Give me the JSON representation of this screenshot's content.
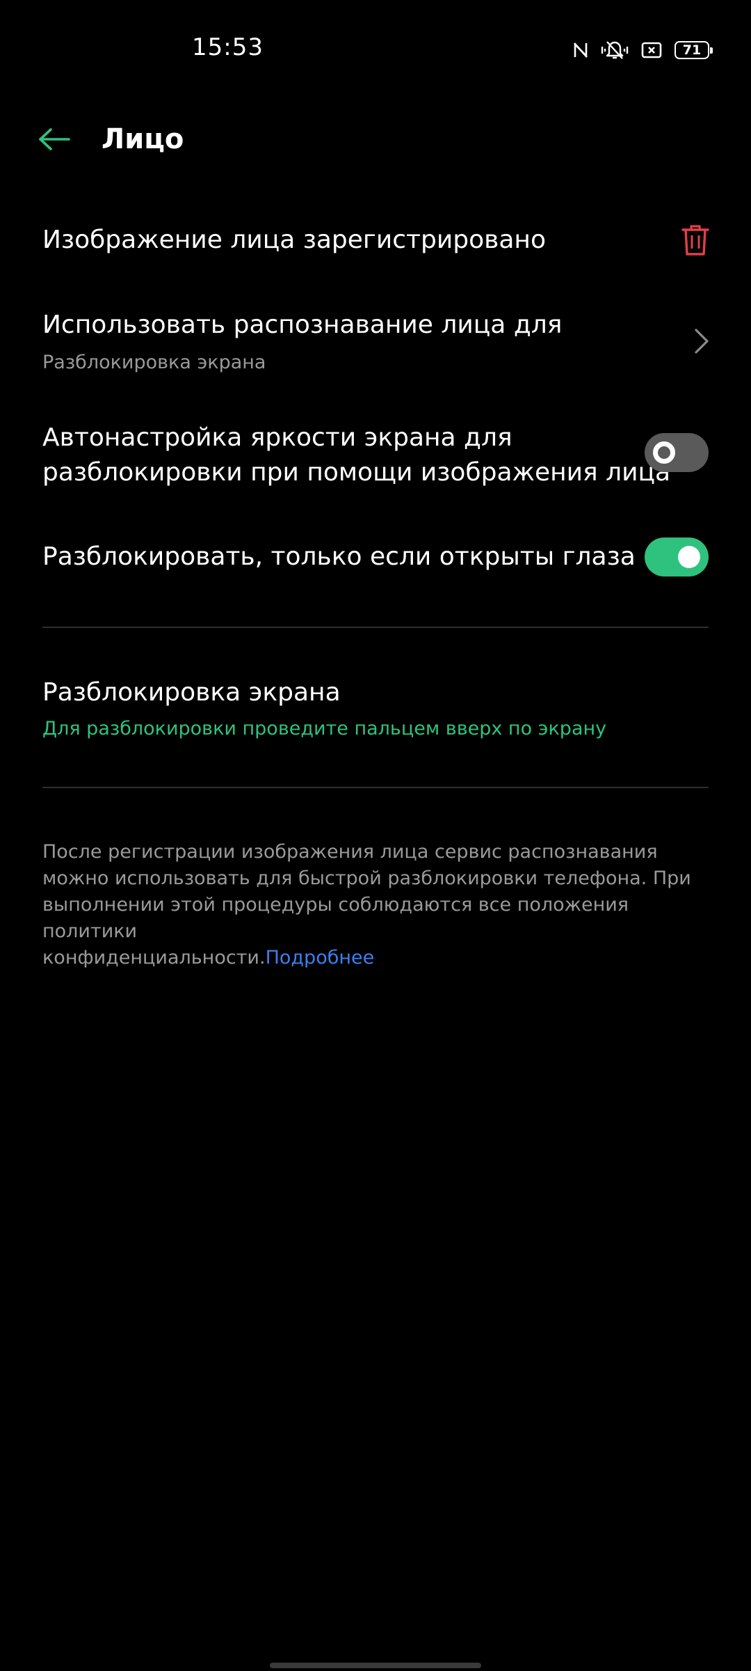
{
  "status_bar": {
    "time": "15:53",
    "battery_level": "71",
    "icons": [
      "nfc-icon",
      "vibrate-icon",
      "screen-record-icon",
      "battery-icon"
    ]
  },
  "header": {
    "title": "Лицо",
    "back_icon": "arrow-left-icon"
  },
  "settings": {
    "face_registered": {
      "label": "Изображение лица зарегистрировано",
      "icon": "trash-icon"
    },
    "use_for": {
      "label": "Использовать распознавание лица для",
      "value": "Разблокировка экрана",
      "icon": "chevron-right-icon"
    },
    "auto_brightness": {
      "line1": "Автонастройка яркости экрана для",
      "line2": "разблокировки при помощи изображения лица",
      "enabled": false
    },
    "eyes_open": {
      "label": "Разблокировать, только если открыты глаза",
      "enabled": true
    },
    "screen_unlock": {
      "label": "Разблокировка экрана",
      "value": "Для разблокировки проведите пальцем вверх по экрану"
    }
  },
  "footer": {
    "line1": "После регистрации изображения лица сервис распознавания",
    "line2": "можно использовать для быстрой разблокировки телефона. При",
    "line3": "выполнении этой процедуры соблюдаются все положения политики",
    "line4_text": "конфиденциальности.",
    "link": "Подробнее"
  },
  "colors": {
    "accent": "#2ec27e",
    "danger": "#e0404a",
    "link": "#3d7ff0",
    "background": "#000000",
    "secondary_text": "#9a9a9a"
  }
}
